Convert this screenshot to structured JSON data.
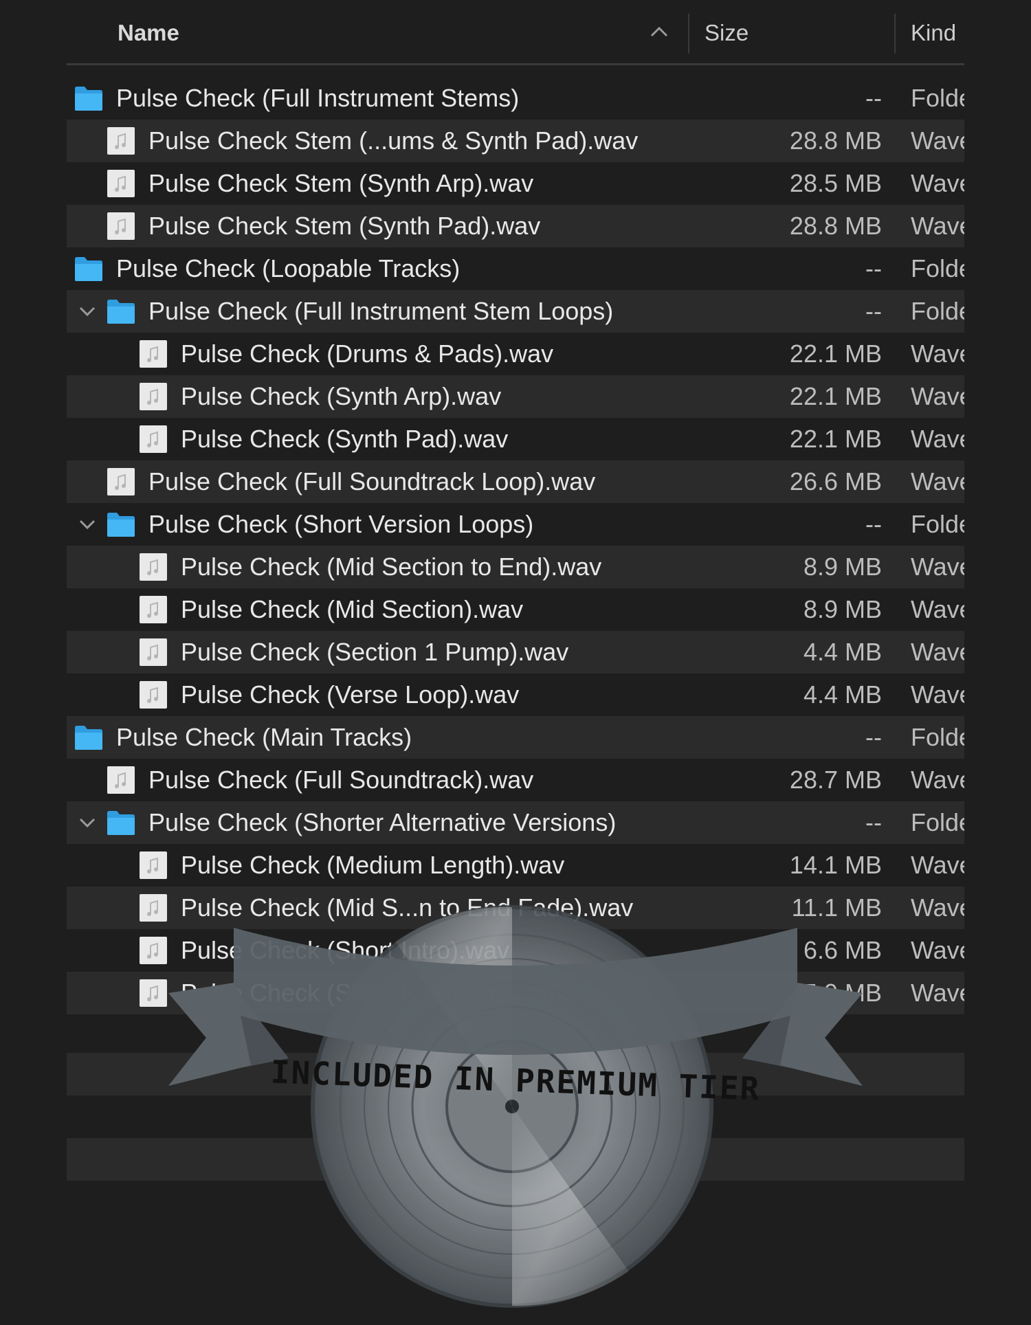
{
  "header": {
    "name_label": "Name",
    "size_label": "Size",
    "kind_label": "Kind",
    "sort_icon": "chevron-up-icon"
  },
  "rows": [
    {
      "name": "Pulse Check (Full Instrument Stems)",
      "size": "--",
      "kind": "Folder",
      "type": "folder",
      "depth": 0,
      "expanded": false
    },
    {
      "name": "Pulse Check Stem (...ums & Synth Pad).wav",
      "size": "28.8 MB",
      "kind": "Waveform audio",
      "type": "audio",
      "depth": 1
    },
    {
      "name": "Pulse Check Stem (Synth Arp).wav",
      "size": "28.5 MB",
      "kind": "Waveform audio",
      "type": "audio",
      "depth": 1
    },
    {
      "name": "Pulse Check Stem (Synth Pad).wav",
      "size": "28.8 MB",
      "kind": "Waveform audio",
      "type": "audio",
      "depth": 1
    },
    {
      "name": "Pulse Check (Loopable Tracks)",
      "size": "--",
      "kind": "Folder",
      "type": "folder",
      "depth": 0,
      "expanded": false
    },
    {
      "name": "Pulse Check (Full Instrument Stem Loops)",
      "size": "--",
      "kind": "Folder",
      "type": "folder",
      "depth": 1,
      "expanded": true
    },
    {
      "name": "Pulse Check (Drums & Pads).wav",
      "size": "22.1 MB",
      "kind": "Waveform audio",
      "type": "audio",
      "depth": 2
    },
    {
      "name": "Pulse Check (Synth Arp).wav",
      "size": "22.1 MB",
      "kind": "Waveform audio",
      "type": "audio",
      "depth": 2
    },
    {
      "name": "Pulse Check (Synth Pad).wav",
      "size": "22.1 MB",
      "kind": "Waveform audio",
      "type": "audio",
      "depth": 2
    },
    {
      "name": "Pulse Check (Full Soundtrack Loop).wav",
      "size": "26.6 MB",
      "kind": "Waveform audio",
      "type": "audio",
      "depth": 1
    },
    {
      "name": "Pulse Check (Short Version Loops)",
      "size": "--",
      "kind": "Folder",
      "type": "folder",
      "depth": 1,
      "expanded": true
    },
    {
      "name": "Pulse Check (Mid Section to End).wav",
      "size": "8.9 MB",
      "kind": "Waveform audio",
      "type": "audio",
      "depth": 2
    },
    {
      "name": "Pulse Check (Mid Section).wav",
      "size": "8.9 MB",
      "kind": "Waveform audio",
      "type": "audio",
      "depth": 2
    },
    {
      "name": "Pulse Check (Section 1 Pump).wav",
      "size": "4.4 MB",
      "kind": "Waveform audio",
      "type": "audio",
      "depth": 2
    },
    {
      "name": "Pulse Check (Verse Loop).wav",
      "size": "4.4 MB",
      "kind": "Waveform audio",
      "type": "audio",
      "depth": 2
    },
    {
      "name": "Pulse Check (Main Tracks)",
      "size": "--",
      "kind": "Folder",
      "type": "folder",
      "depth": 0,
      "expanded": false
    },
    {
      "name": "Pulse Check (Full Soundtrack).wav",
      "size": "28.7 MB",
      "kind": "Waveform audio",
      "type": "audio",
      "depth": 1
    },
    {
      "name": "Pulse Check (Shorter Alternative Versions)",
      "size": "--",
      "kind": "Folder",
      "type": "folder",
      "depth": 1,
      "expanded": true
    },
    {
      "name": "Pulse Check (Medium Length).wav",
      "size": "14.1 MB",
      "kind": "Waveform audio",
      "type": "audio",
      "depth": 2
    },
    {
      "name": "Pulse Check (Mid S...n to End Fade).wav",
      "size": "11.1 MB",
      "kind": "Waveform audio",
      "type": "audio",
      "depth": 2
    },
    {
      "name": "Pulse Check (Short Intro).wav",
      "size": "6.6 MB",
      "kind": "Waveform audio",
      "type": "audio",
      "depth": 2
    },
    {
      "name": "Pulse Check (Short Pump Section).wav",
      "size": "5.9 MB",
      "kind": "Waveform audio",
      "type": "audio",
      "depth": 2
    }
  ],
  "badge": {
    "text": "INCLUDED IN PREMIUM TIER",
    "icon": "vinyl-record-icon"
  },
  "colors": {
    "background": "#1e1e1e",
    "row_alt": "#2b2b2b",
    "folder_blue": "#3ab0f0",
    "ribbon": "#5b6368"
  }
}
